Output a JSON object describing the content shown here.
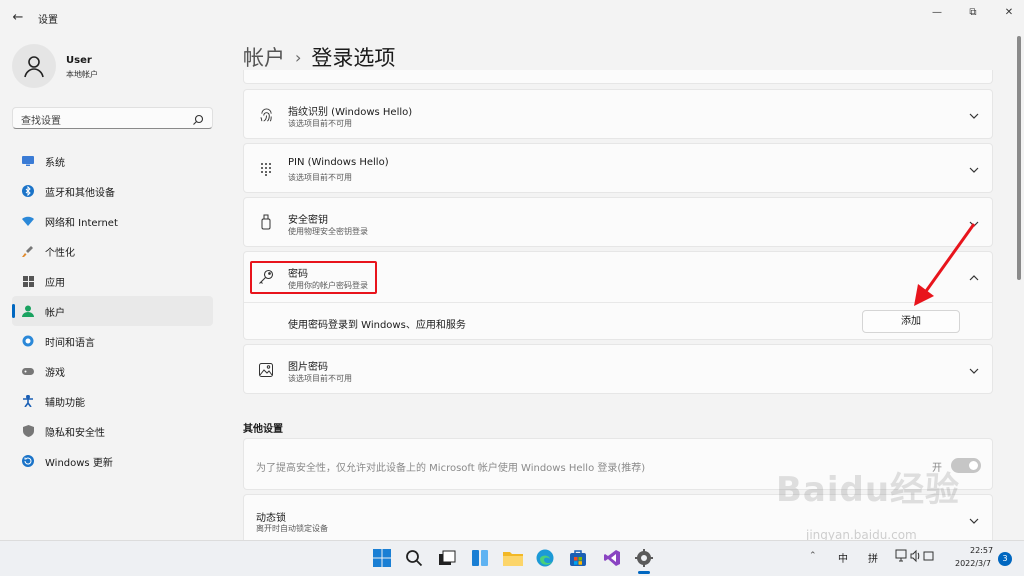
{
  "window": {
    "title": "设置",
    "back_icon": "←",
    "minimize_icon": "—",
    "restore_icon": "⧉",
    "close_icon": "✕"
  },
  "user": {
    "name": "User",
    "type": "本地帐户"
  },
  "search": {
    "placeholder": "查找设置"
  },
  "nav": {
    "items": [
      {
        "label": "系统",
        "icon": "monitor-icon"
      },
      {
        "label": "蓝牙和其他设备",
        "icon": "bluetooth-icon"
      },
      {
        "label": "网络和 Internet",
        "icon": "wifi-icon"
      },
      {
        "label": "个性化",
        "icon": "brush-icon"
      },
      {
        "label": "应用",
        "icon": "apps-icon"
      },
      {
        "label": "帐户",
        "icon": "person-icon",
        "active": true
      },
      {
        "label": "时间和语言",
        "icon": "globe-icon"
      },
      {
        "label": "游戏",
        "icon": "gamepad-icon"
      },
      {
        "label": "辅助功能",
        "icon": "accessibility-icon"
      },
      {
        "label": "隐私和安全性",
        "icon": "shield-icon"
      },
      {
        "label": "Windows 更新",
        "icon": "update-icon"
      }
    ]
  },
  "breadcrumb": {
    "parent": "帐户",
    "separator": "›",
    "current": "登录选项"
  },
  "cards": {
    "fingerprint": {
      "title": "指纹识别 (Windows Hello)",
      "subtitle": "该选项目前不可用"
    },
    "pin": {
      "title": "PIN (Windows Hello)",
      "subtitle": "该选项目前不可用"
    },
    "security_key": {
      "title": "安全密钥",
      "subtitle": "使用物理安全密钥登录"
    },
    "password": {
      "title": "密码",
      "subtitle": "使用你的帐户密码登录",
      "detail": "使用密码登录到 Windows、应用和服务",
      "button": "添加"
    },
    "picture_password": {
      "title": "图片密码",
      "subtitle": "该选项目前不可用"
    }
  },
  "other_settings": {
    "heading": "其他设置",
    "hello_only": {
      "text": "为了提高安全性，仅允许对此设备上的 Microsoft 帐户使用 Windows Hello 登录(推荐)",
      "state": "开"
    },
    "dynamic_lock": {
      "title": "动态锁",
      "subtitle": "离开时自动锁定设备"
    }
  },
  "taskbar": {
    "icons": [
      "windows-start-icon",
      "search-icon",
      "task-view-icon",
      "widgets-icon",
      "file-explorer-icon",
      "edge-icon",
      "store-icon",
      "visual-studio-icon",
      "settings-icon"
    ],
    "tray": {
      "lang": "中",
      "ime": "拼",
      "time": "22:57",
      "date": "2022/3/7",
      "notifications": "3"
    }
  },
  "watermark": {
    "text": "Baidu经验",
    "sub": "jingyan.baidu.com"
  },
  "colors": {
    "accent": "#0067c0",
    "highlight": "#e8141c"
  }
}
